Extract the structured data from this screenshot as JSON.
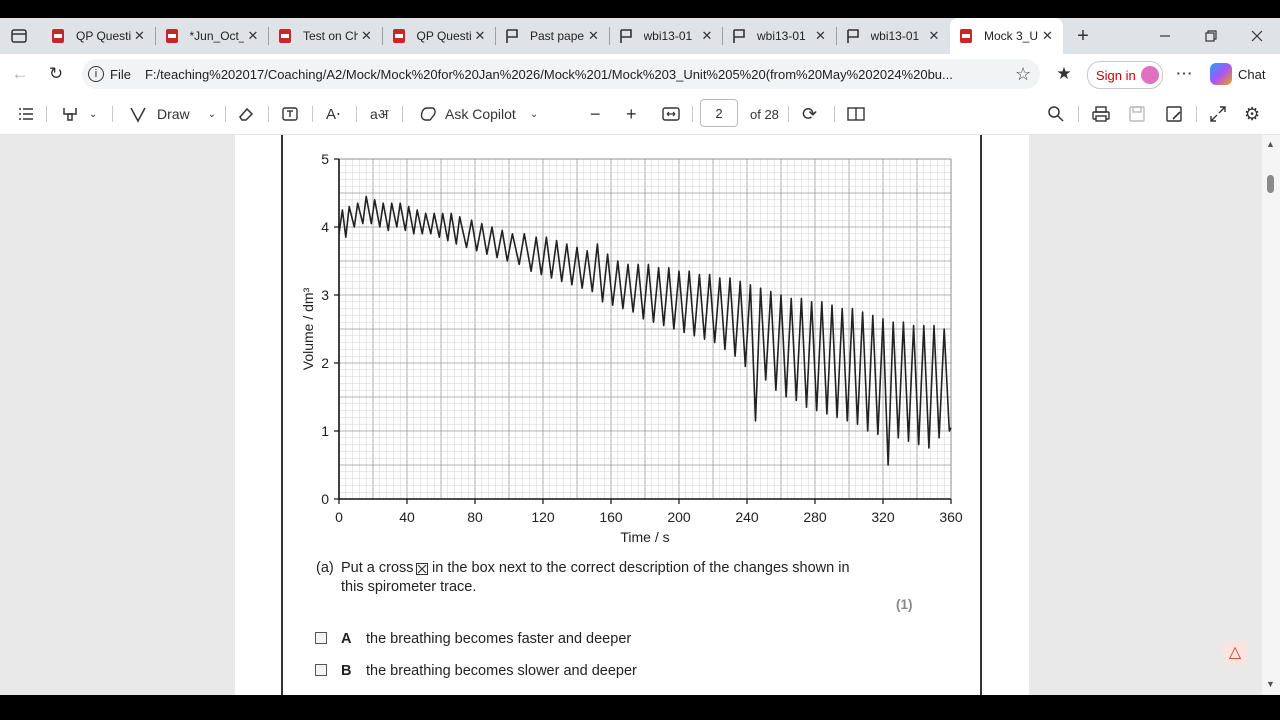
{
  "browser": {
    "tabs": [
      {
        "title": "QP Questi",
        "icon": "pdf-icon",
        "active": false
      },
      {
        "title": "*Jun_Oct_",
        "icon": "pdf-icon",
        "active": false
      },
      {
        "title": "Test on Ch",
        "icon": "pdf-icon",
        "active": false
      },
      {
        "title": "QP Questi",
        "icon": "pdf-icon",
        "active": false
      },
      {
        "title": "Past pape",
        "icon": "flag-icon",
        "active": false
      },
      {
        "title": "wbi13-01",
        "icon": "flag-icon",
        "active": false
      },
      {
        "title": "wbi13-01",
        "icon": "flag-icon",
        "active": false
      },
      {
        "title": "wbi13-01",
        "icon": "flag-icon",
        "active": false
      },
      {
        "title": "Mock 3_U",
        "icon": "pdf-icon",
        "active": true
      }
    ],
    "url_label": "File",
    "url": "F:/teaching%202017/Coaching/A2/Mock/Mock%20for%20Jan%2026/Mock%201/Mock%203_Unit%205%20(from%20May%202024%20bu...",
    "sign_in": "Sign in",
    "chat": "Chat"
  },
  "pdf_toolbar": {
    "draw_label": "Draw",
    "copilot_label": "Ask Copilot",
    "page_current": "2",
    "page_total": "of 28"
  },
  "document": {
    "question_part": "(a)",
    "question_line1_a": "Put a cross",
    "question_line1_b": "in the box next to the correct description of the changes shown in",
    "question_line2": "this spirometer trace.",
    "marks": "(1)",
    "options": [
      {
        "letter": "A",
        "text": "the breathing becomes faster and deeper"
      },
      {
        "letter": "B",
        "text": "the breathing becomes slower and deeper"
      }
    ]
  },
  "chart_data": {
    "type": "line",
    "xlabel": "Time / s",
    "ylabel": "Volume / dm³",
    "xlim": [
      0,
      360
    ],
    "ylim": [
      0,
      5
    ],
    "x_ticks": [
      0,
      40,
      80,
      120,
      160,
      200,
      240,
      280,
      320,
      360
    ],
    "y_ticks": [
      0,
      1,
      2,
      3,
      4,
      5
    ],
    "grid": true,
    "series": [
      {
        "x": [
          0,
          2,
          4,
          6,
          9,
          11,
          14,
          16,
          19,
          21,
          24,
          26,
          29,
          31,
          34,
          36,
          39,
          41,
          44,
          46,
          49,
          51,
          54,
          56,
          59,
          61,
          64,
          66,
          69,
          71,
          75,
          78,
          81,
          84,
          87,
          90,
          93,
          96,
          99,
          102,
          106,
          109,
          113,
          116,
          119,
          122,
          125,
          128,
          131,
          134,
          137,
          140,
          143,
          146,
          149,
          152,
          155,
          158,
          161,
          164,
          167,
          170,
          173,
          176,
          179,
          182,
          185,
          188,
          191,
          194,
          197,
          200,
          203,
          206,
          209,
          212,
          215,
          218,
          221,
          224,
          227,
          230,
          233,
          236,
          239,
          242,
          245,
          248,
          251,
          254,
          257,
          260,
          263,
          266,
          269,
          272,
          275,
          278,
          281,
          284,
          287,
          290,
          293,
          296,
          299,
          302,
          305,
          308,
          311,
          314,
          317,
          320,
          323,
          326,
          329,
          332,
          335,
          338,
          341,
          344,
          347,
          350,
          353,
          356,
          359,
          360
        ],
        "y": [
          3.9,
          4.25,
          3.85,
          4.3,
          4.0,
          4.35,
          4.05,
          4.45,
          4.05,
          4.4,
          4.0,
          4.35,
          3.95,
          4.35,
          4.0,
          4.35,
          3.95,
          4.3,
          3.9,
          4.25,
          3.9,
          4.2,
          3.9,
          4.2,
          3.85,
          4.2,
          3.8,
          4.2,
          3.75,
          4.15,
          3.7,
          4.1,
          3.65,
          4.05,
          3.6,
          4.0,
          3.55,
          3.95,
          3.5,
          3.9,
          3.45,
          3.9,
          3.35,
          3.85,
          3.3,
          3.85,
          3.25,
          3.8,
          3.2,
          3.75,
          3.15,
          3.7,
          3.1,
          3.65,
          3.05,
          3.75,
          2.9,
          3.6,
          2.85,
          3.5,
          2.8,
          3.45,
          2.75,
          3.45,
          2.65,
          3.45,
          2.6,
          3.4,
          2.55,
          3.4,
          2.5,
          3.35,
          2.45,
          3.35,
          2.4,
          3.3,
          2.35,
          3.3,
          2.3,
          3.25,
          2.2,
          3.25,
          2.1,
          3.2,
          1.95,
          3.15,
          1.15,
          3.1,
          1.75,
          3.05,
          1.6,
          3.0,
          1.5,
          2.95,
          1.45,
          2.95,
          1.35,
          2.9,
          1.3,
          2.9,
          1.25,
          2.85,
          1.2,
          2.8,
          1.15,
          2.8,
          1.1,
          2.75,
          1.0,
          2.7,
          0.95,
          2.65,
          0.5,
          2.6,
          0.9,
          2.6,
          0.85,
          2.55,
          0.8,
          2.55,
          0.75,
          2.55,
          0.9,
          2.5,
          1.0,
          1.05
        ]
      }
    ]
  }
}
